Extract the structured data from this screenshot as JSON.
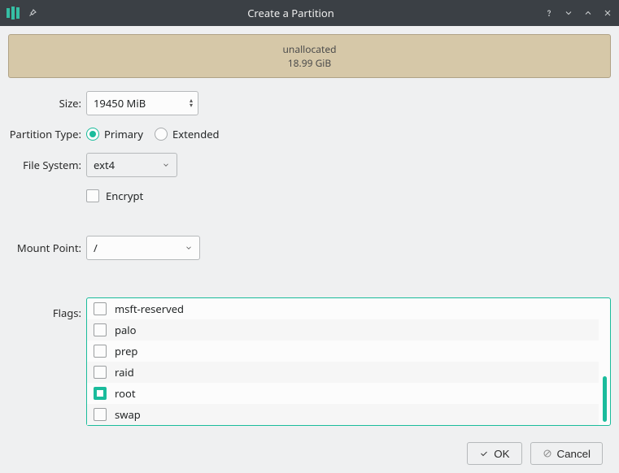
{
  "window": {
    "title": "Create a Partition"
  },
  "disk": {
    "label": "unallocated",
    "size": "18.99 GiB"
  },
  "fields": {
    "size": {
      "label": "Size:",
      "value": "19450 MiB"
    },
    "partition_type": {
      "label": "Partition Type:",
      "options": {
        "primary": "Primary",
        "extended": "Extended"
      },
      "selected": "primary"
    },
    "filesystem": {
      "label": "File System:",
      "value": "ext4"
    },
    "encrypt": {
      "label": "Encrypt",
      "checked": false
    },
    "mount_point": {
      "label": "Mount Point:",
      "value": "/"
    },
    "flags": {
      "label": "Flags:",
      "visible": [
        {
          "name": "msft-reserved",
          "checked": false
        },
        {
          "name": "palo",
          "checked": false
        },
        {
          "name": "prep",
          "checked": false
        },
        {
          "name": "raid",
          "checked": false
        },
        {
          "name": "root",
          "checked": true
        },
        {
          "name": "swap",
          "checked": false
        }
      ]
    }
  },
  "buttons": {
    "ok": "OK",
    "cancel": "Cancel"
  }
}
